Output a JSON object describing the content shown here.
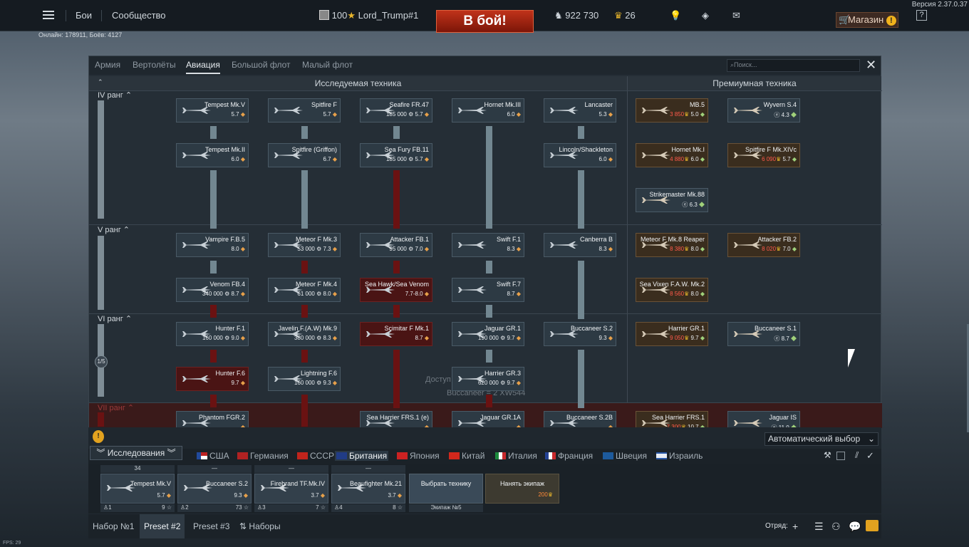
{
  "header": {
    "version": "Версия 2.37.0.37",
    "menu_battles": "Бои",
    "menu_community": "Сообщество",
    "player_level": "100",
    "player_name": "Lord_Trump#1",
    "battle_button": "В бой!",
    "silver_lions": "922 730",
    "golden_eagles": "26",
    "shop_button": "Магазин",
    "help": "?",
    "online": "Онлайн: 178911, Боёв: 4127"
  },
  "tabs": {
    "army": "Армия",
    "helicopters": "Вертолёты",
    "aviation": "Авиация",
    "fleet": "Большой флот",
    "coastal": "Малый флот",
    "search_placeholder": "Поиск..."
  },
  "sections": {
    "research": "Исследуемая техника",
    "premium": "Премиумная техника"
  },
  "ranks": {
    "r4": "IV ранг",
    "r5": "V ранг",
    "r6": "VI ранг",
    "r7": "VII ранг",
    "progress": "1/5"
  },
  "hint": {
    "line1": "Доступ",
    "line2": "Buccaneer = 2 XW544"
  },
  "cards": [
    {
      "name": "Tempest Mk.V",
      "br": "5.7"
    },
    {
      "name": "Spitfire F",
      "br": "5.7"
    },
    {
      "name": "Seafire FR.47",
      "cost": "185 000",
      "br": "5.7"
    },
    {
      "name": "Hornet Mk.III",
      "br": "6.0"
    },
    {
      "name": "Lancaster",
      "br": "5.3"
    },
    {
      "name": "Tempest Mk.II",
      "br": "6.0"
    },
    {
      "name": "Spitfire (Griffon)",
      "br": "6.7"
    },
    {
      "name": "Sea Fury FB.11",
      "cost": "185 000",
      "br": "5.7"
    },
    {
      "name": "Lincoln/Shackleton",
      "br": "6.0"
    },
    {
      "name": "Vampire F.B.5",
      "br": "8.0"
    },
    {
      "name": "Meteor F Mk.3",
      "cost": "53 000",
      "br": "7.3"
    },
    {
      "name": "Attacker FB.1",
      "cost": "95 000",
      "br": "7.0"
    },
    {
      "name": "Swift F.1",
      "br": "8.3"
    },
    {
      "name": "Canberra B",
      "br": "8.3"
    },
    {
      "name": "Venom FB.4",
      "cost": "340 000",
      "br": "8.7"
    },
    {
      "name": "Meteor F Mk.4",
      "cost": "61 000",
      "br": "8.0"
    },
    {
      "name": "Sea Hawk/Sea Venom",
      "br": "7.7-8.0"
    },
    {
      "name": "Swift F.7",
      "br": "8.7"
    },
    {
      "name": "Hunter F.1",
      "cost": "160 000",
      "br": "9.0"
    },
    {
      "name": "Javelin F.(A.W) Mk.9",
      "cost": "380 000",
      "br": "8.3"
    },
    {
      "name": "Scimitar F Mk.1",
      "br": "8.7"
    },
    {
      "name": "Jaguar GR.1",
      "cost": "190 000",
      "br": "9.7"
    },
    {
      "name": "Buccaneer S.2",
      "br": "9.3"
    },
    {
      "name": "Hunter F.6",
      "br": "9.7"
    },
    {
      "name": "Lightning F.6",
      "cost": "160 000",
      "br": "9.3"
    },
    {
      "name": "Harrier GR.3",
      "cost": "620 000",
      "br": "9.7"
    },
    {
      "name": "Phantom FGR.2",
      "br": ""
    },
    {
      "name": "Sea Harrier FRS.1 (e)",
      "br": ""
    },
    {
      "name": "Jaguar GR.1A",
      "br": ""
    },
    {
      "name": "Buccaneer S.2B",
      "br": ""
    }
  ],
  "premium": [
    {
      "name": "MB.5",
      "gold": "3 850",
      "br": "5.0"
    },
    {
      "name": "Wyvern S.4",
      "br": "4.3"
    },
    {
      "name": "Hornet Mk.I",
      "gold": "4 880",
      "br": "6.0"
    },
    {
      "name": "Spitfire F Mk.XIVc",
      "gold": "6 090",
      "br": "5.7"
    },
    {
      "name": "Strikemaster Mk.88",
      "br": "6.3"
    },
    {
      "name": "Meteor F Mk.8 Reaper",
      "gold": "8 380",
      "br": "8.0"
    },
    {
      "name": "Attacker FB.2",
      "gold": "8 020",
      "br": "7.0"
    },
    {
      "name": "Sea Vixen F.A.W. Mk.2",
      "gold": "8 560",
      "br": "8.0"
    },
    {
      "name": "Harrier GR.1",
      "gold": "9 050",
      "br": "9.7"
    },
    {
      "name": "Buccaneer S.1",
      "br": "8.7"
    },
    {
      "name": "Sea Harrier FRS.1",
      "gold": "7 300",
      "br": "10.7"
    },
    {
      "name": "Jaguar IS",
      "br": "11.0"
    }
  ],
  "auto_select": "Автоматический выбор",
  "research_tab": "Исследования",
  "nations": [
    "США",
    "Германия",
    "СССР",
    "Британия",
    "Япония",
    "Китай",
    "Италия",
    "Франция",
    "Швеция",
    "Израиль"
  ],
  "crew": {
    "slots": [
      {
        "top": "34",
        "name": "Tempest Mk.V",
        "br": "5.7",
        "num": "1",
        "rp": "9"
      },
      {
        "top": "—",
        "name": "Buccaneer S.2",
        "br": "9.3",
        "num": "2",
        "rp": "73"
      },
      {
        "top": "—",
        "name": "Firebrand TF.Mk.IV",
        "br": "3.7",
        "num": "3",
        "rp": "7"
      },
      {
        "top": "—",
        "name": "Beaufighter Mk.21",
        "br": "3.7",
        "num": "4",
        "rp": "8"
      }
    ],
    "choose": "Выбрать технику",
    "crew_label": "Экипаж №5",
    "hire": "Нанять экипаж",
    "hire_cost": "200"
  },
  "presets": [
    "Набор №1",
    "Preset #2",
    "Preset #3",
    "Наборы"
  ],
  "squad": "Отряд:",
  "fps": "FPS: 29"
}
